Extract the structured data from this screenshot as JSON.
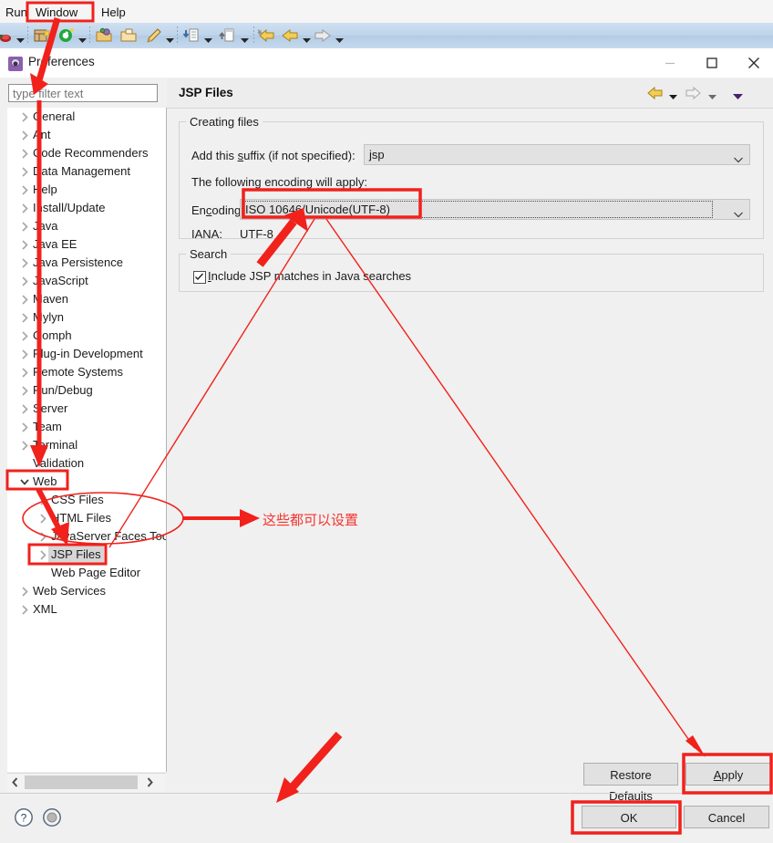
{
  "ide": {
    "menu": [
      {
        "label": "Run",
        "name": "menu-run"
      },
      {
        "label": "Window",
        "name": "menu-window"
      },
      {
        "label": "Help",
        "name": "menu-help"
      }
    ],
    "toolbar_icons": [
      "debug-icon",
      "new-wizard-icon",
      "run-icon",
      "open-type-icon",
      "open-resource-icon",
      "edit-icon",
      "import-icon",
      "export-icon",
      "back-history-icon",
      "back-icon",
      "forward-icon"
    ]
  },
  "dialog": {
    "title": "Preferences",
    "icon": "preferences-gear-icon",
    "window_buttons": {
      "minimize": "minimize-icon",
      "maximize": "maximize-icon",
      "close": "close-icon"
    }
  },
  "filter": {
    "placeholder": "type filter text",
    "value": ""
  },
  "tree": {
    "items": [
      {
        "label": "General",
        "indent": 0,
        "twisty": "collapsed",
        "selected": false
      },
      {
        "label": "Ant",
        "indent": 0,
        "twisty": "collapsed",
        "selected": false
      },
      {
        "label": "Code Recommenders",
        "indent": 0,
        "twisty": "collapsed",
        "selected": false
      },
      {
        "label": "Data Management",
        "indent": 0,
        "twisty": "collapsed",
        "selected": false
      },
      {
        "label": "Help",
        "indent": 0,
        "twisty": "collapsed",
        "selected": false
      },
      {
        "label": "Install/Update",
        "indent": 0,
        "twisty": "collapsed",
        "selected": false
      },
      {
        "label": "Java",
        "indent": 0,
        "twisty": "collapsed",
        "selected": false
      },
      {
        "label": "Java EE",
        "indent": 0,
        "twisty": "collapsed",
        "selected": false
      },
      {
        "label": "Java Persistence",
        "indent": 0,
        "twisty": "collapsed",
        "selected": false
      },
      {
        "label": "JavaScript",
        "indent": 0,
        "twisty": "collapsed",
        "selected": false
      },
      {
        "label": "Maven",
        "indent": 0,
        "twisty": "collapsed",
        "selected": false
      },
      {
        "label": "Mylyn",
        "indent": 0,
        "twisty": "collapsed",
        "selected": false
      },
      {
        "label": "Oomph",
        "indent": 0,
        "twisty": "collapsed",
        "selected": false
      },
      {
        "label": "Plug-in Development",
        "indent": 0,
        "twisty": "collapsed",
        "selected": false
      },
      {
        "label": "Remote Systems",
        "indent": 0,
        "twisty": "collapsed",
        "selected": false
      },
      {
        "label": "Run/Debug",
        "indent": 0,
        "twisty": "collapsed",
        "selected": false
      },
      {
        "label": "Server",
        "indent": 0,
        "twisty": "collapsed",
        "selected": false
      },
      {
        "label": "Team",
        "indent": 0,
        "twisty": "collapsed",
        "selected": false
      },
      {
        "label": "Terminal",
        "indent": 0,
        "twisty": "collapsed",
        "selected": false
      },
      {
        "label": "Validation",
        "indent": 0,
        "twisty": "none",
        "selected": false
      },
      {
        "label": "Web",
        "indent": 0,
        "twisty": "expanded",
        "selected": false
      },
      {
        "label": "CSS Files",
        "indent": 1,
        "twisty": "collapsed",
        "selected": false
      },
      {
        "label": "HTML Files",
        "indent": 1,
        "twisty": "collapsed",
        "selected": false
      },
      {
        "label": "JavaServer Faces Too",
        "indent": 1,
        "twisty": "collapsed",
        "selected": false
      },
      {
        "label": "JSP Files",
        "indent": 1,
        "twisty": "collapsed",
        "selected": true
      },
      {
        "label": "Web Page Editor",
        "indent": 1,
        "twisty": "none",
        "selected": false
      },
      {
        "label": "Web Services",
        "indent": 0,
        "twisty": "collapsed",
        "selected": false
      },
      {
        "label": "XML",
        "indent": 0,
        "twisty": "collapsed",
        "selected": false
      }
    ],
    "hscroll": {
      "left": "scroll-left-icon",
      "right": "scroll-right-icon"
    }
  },
  "page": {
    "title": "JSP Files",
    "nav": {
      "back": "back-arrow-icon",
      "back_menu": "chevron-down-icon",
      "forward": "forward-arrow-icon",
      "forward_menu": "chevron-down-icon",
      "view_menu": "view-menu-icon"
    },
    "creating_files": {
      "group_label": "Creating files",
      "suffix_label": "Add this suffix (if not specified):",
      "suffix_label_pre": "Add this ",
      "suffix_label_key": "s",
      "suffix_label_post": "uffix (if not specified):",
      "suffix_value": "jsp",
      "encoding_note": "The following encoding will apply:",
      "encoding_label_pre": "En",
      "encoding_label_key": "c",
      "encoding_label_post": "oding:",
      "encoding_value": "ISO 10646/Unicode(UTF-8)",
      "iana_label": "IANA:",
      "iana_value": "UTF-8"
    },
    "search": {
      "group_label": "Search",
      "checkbox_label_pre": "",
      "checkbox_label_key": "I",
      "checkbox_label_post": "nclude JSP matches in Java searches",
      "checkbox_label": "Include JSP matches in Java searches",
      "checked": true
    }
  },
  "buttons": {
    "restore_pre": "Restore ",
    "restore_key": "D",
    "restore_post": "efaults",
    "restore": "Restore Defaults",
    "apply_pre": "",
    "apply_key": "A",
    "apply_post": "pply",
    "apply": "Apply",
    "ok": "OK",
    "cancel": "Cancel",
    "help_icon": "help-question-icon",
    "secondary_icon": "circle-icon"
  },
  "annotations": {
    "accent_color": "#f1211c",
    "note_text": "这些都可以设置",
    "boxes": [
      "window-menu-box",
      "encoding-field-box",
      "web-node-box",
      "jsp-files-node-box",
      "apply-button-box",
      "ok-button-box"
    ],
    "arrows": [
      "arrow-to-filter",
      "arrow-down-tree",
      "arrow-to-web-child",
      "arrow-to-encoding",
      "arrow-to-ok",
      "arrow-to-note"
    ],
    "ellipse": "web-children-ellipse"
  }
}
